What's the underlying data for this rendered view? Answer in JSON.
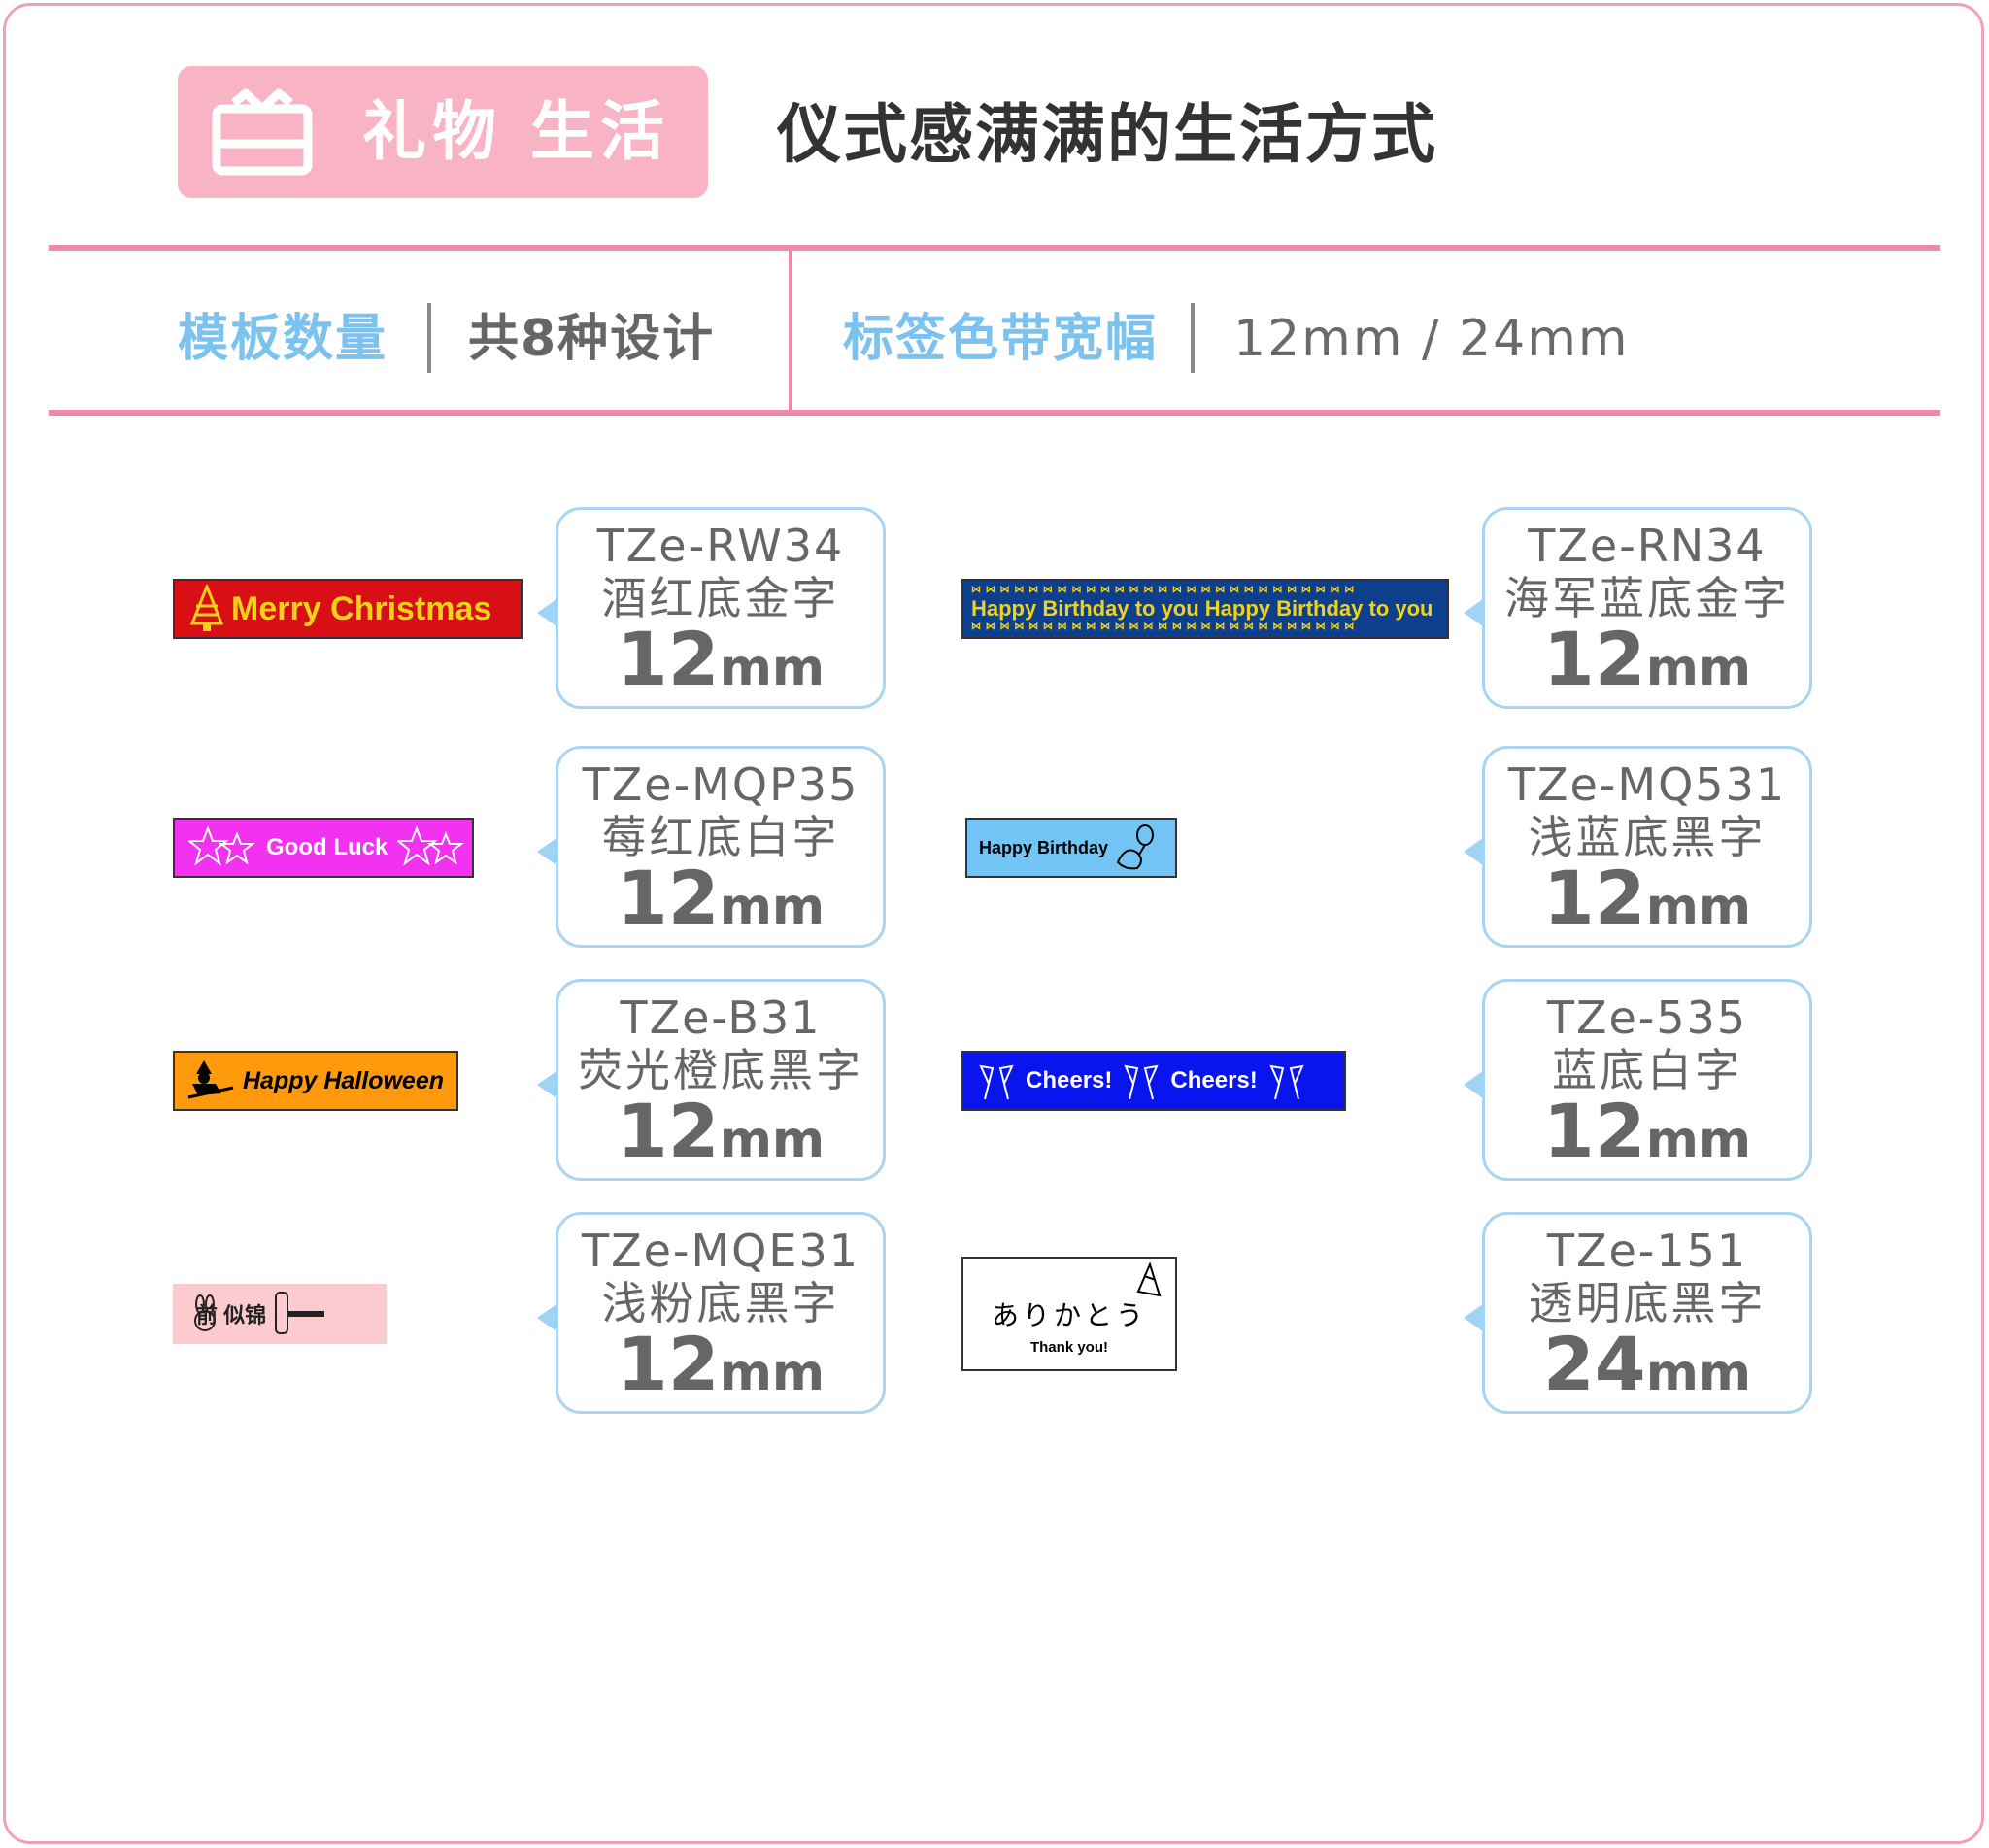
{
  "header": {
    "category": "礼物 生活",
    "category_icon": "gift-box-icon",
    "headline": "仪式感满满的生活方式"
  },
  "info": {
    "template_count_label": "模板数量",
    "template_count_value": "共8种设计",
    "tape_width_label": "标签色带宽幅",
    "tape_width_value": "12mm  /  24mm"
  },
  "colors": {
    "accent_pink": "#ee8aa3",
    "category_bg": "#f8b4c4",
    "label_blue": "#7cc2ee",
    "callout_border": "#a6d6f4"
  },
  "products": [
    {
      "tape_text": "Merry Christmas",
      "tape_icon": "christmas-tree-icon",
      "tape_bg": "#d80f15",
      "tape_fg": "#f0d21b",
      "code": "TZe-RW34",
      "desc": "酒红底金字",
      "width_num": "12",
      "width_unit": "mm"
    },
    {
      "tape_text": "Good Luck",
      "tape_icon": "star-icon",
      "tape_bg": "#f232f0",
      "tape_fg": "#ffffff",
      "code": "TZe-MQP35",
      "desc": "莓红底白字",
      "width_num": "12",
      "width_unit": "mm"
    },
    {
      "tape_text": "Happy Halloween",
      "tape_icon": "witch-icon",
      "tape_bg": "#ff9a0c",
      "tape_fg": "#000000",
      "code": "TZe-B31",
      "desc": "荧光橙底黑字",
      "width_num": "12",
      "width_unit": "mm"
    },
    {
      "tape_text": "前 似锦",
      "tape_icon": "rabbit-icon",
      "tape_bg": "#fbcbd0",
      "tape_fg": "#222222",
      "code": "TZe-MQE31",
      "desc": "浅粉底黑字",
      "width_num": "12",
      "width_unit": "mm"
    },
    {
      "tape_text": "Happy Birthday to you  Happy Birthday to you",
      "tape_icon": "bow-icon",
      "tape_bg": "#0e3f8c",
      "tape_fg": "#f0d21b",
      "code": "TZe-RN34",
      "desc": "海军蓝底金字",
      "width_num": "12",
      "width_unit": "mm"
    },
    {
      "tape_text": "Happy Birthday",
      "tape_icon": "dinosaur-balloon-icon",
      "tape_bg": "#72c4f5",
      "tape_fg": "#000000",
      "code": "TZe-MQ531",
      "desc": "浅蓝底黑字",
      "width_num": "12",
      "width_unit": "mm"
    },
    {
      "tape_text": "Cheers!",
      "tape_text_2": "Cheers!",
      "tape_icon": "champagne-glasses-icon",
      "tape_bg": "#0a14ee",
      "tape_fg": "#ffffff",
      "code": "TZe-535",
      "desc": "蓝底白字",
      "width_num": "12",
      "width_unit": "mm"
    },
    {
      "tape_text": "ありかとう",
      "tape_subtext": "Thank you!",
      "tape_icon": "party-hat-icon",
      "tape_bg": "#ffffff",
      "tape_fg": "#000000",
      "code": "TZe-151",
      "desc": "透明底黑字",
      "width_num": "24",
      "width_unit": "mm"
    }
  ]
}
